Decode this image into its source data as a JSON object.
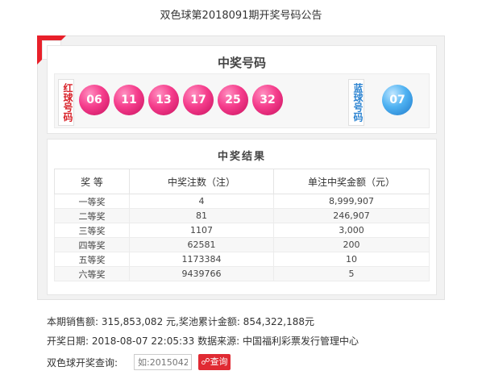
{
  "page_title": "双色球第2018091期开奖号码公告",
  "draw": {
    "title": "中奖号码",
    "red_label": "红球号码",
    "blue_label": "蓝球号码",
    "red_balls": [
      "06",
      "11",
      "13",
      "17",
      "25",
      "32"
    ],
    "blue_ball": "07",
    "colors": {
      "red_ball": "#f53d8c",
      "blue_ball": "#4fb2f2",
      "accent": "#e8202a"
    }
  },
  "results": {
    "title": "中奖结果",
    "headers": [
      "奖 等",
      "中奖注数（注）",
      "单注中奖金额（元）"
    ],
    "rows": [
      [
        "一等奖",
        "4",
        "8,999,907"
      ],
      [
        "二等奖",
        "81",
        "246,907"
      ],
      [
        "三等奖",
        "1107",
        "3,000"
      ],
      [
        "四等奖",
        "62581",
        "200"
      ],
      [
        "五等奖",
        "1173384",
        "10"
      ],
      [
        "六等奖",
        "9439766",
        "5"
      ]
    ]
  },
  "info": {
    "sales": "本期销售额: 315,853,082 元,奖池累计金额: 854,322,188元",
    "date_source": "开奖日期: 2018-08-07 22:05:33 数据来源: 中国福利彩票发行管理中心"
  },
  "query": {
    "label": "双色球开奖查询:",
    "placeholder": "如:2015042",
    "button_label": "查询"
  }
}
